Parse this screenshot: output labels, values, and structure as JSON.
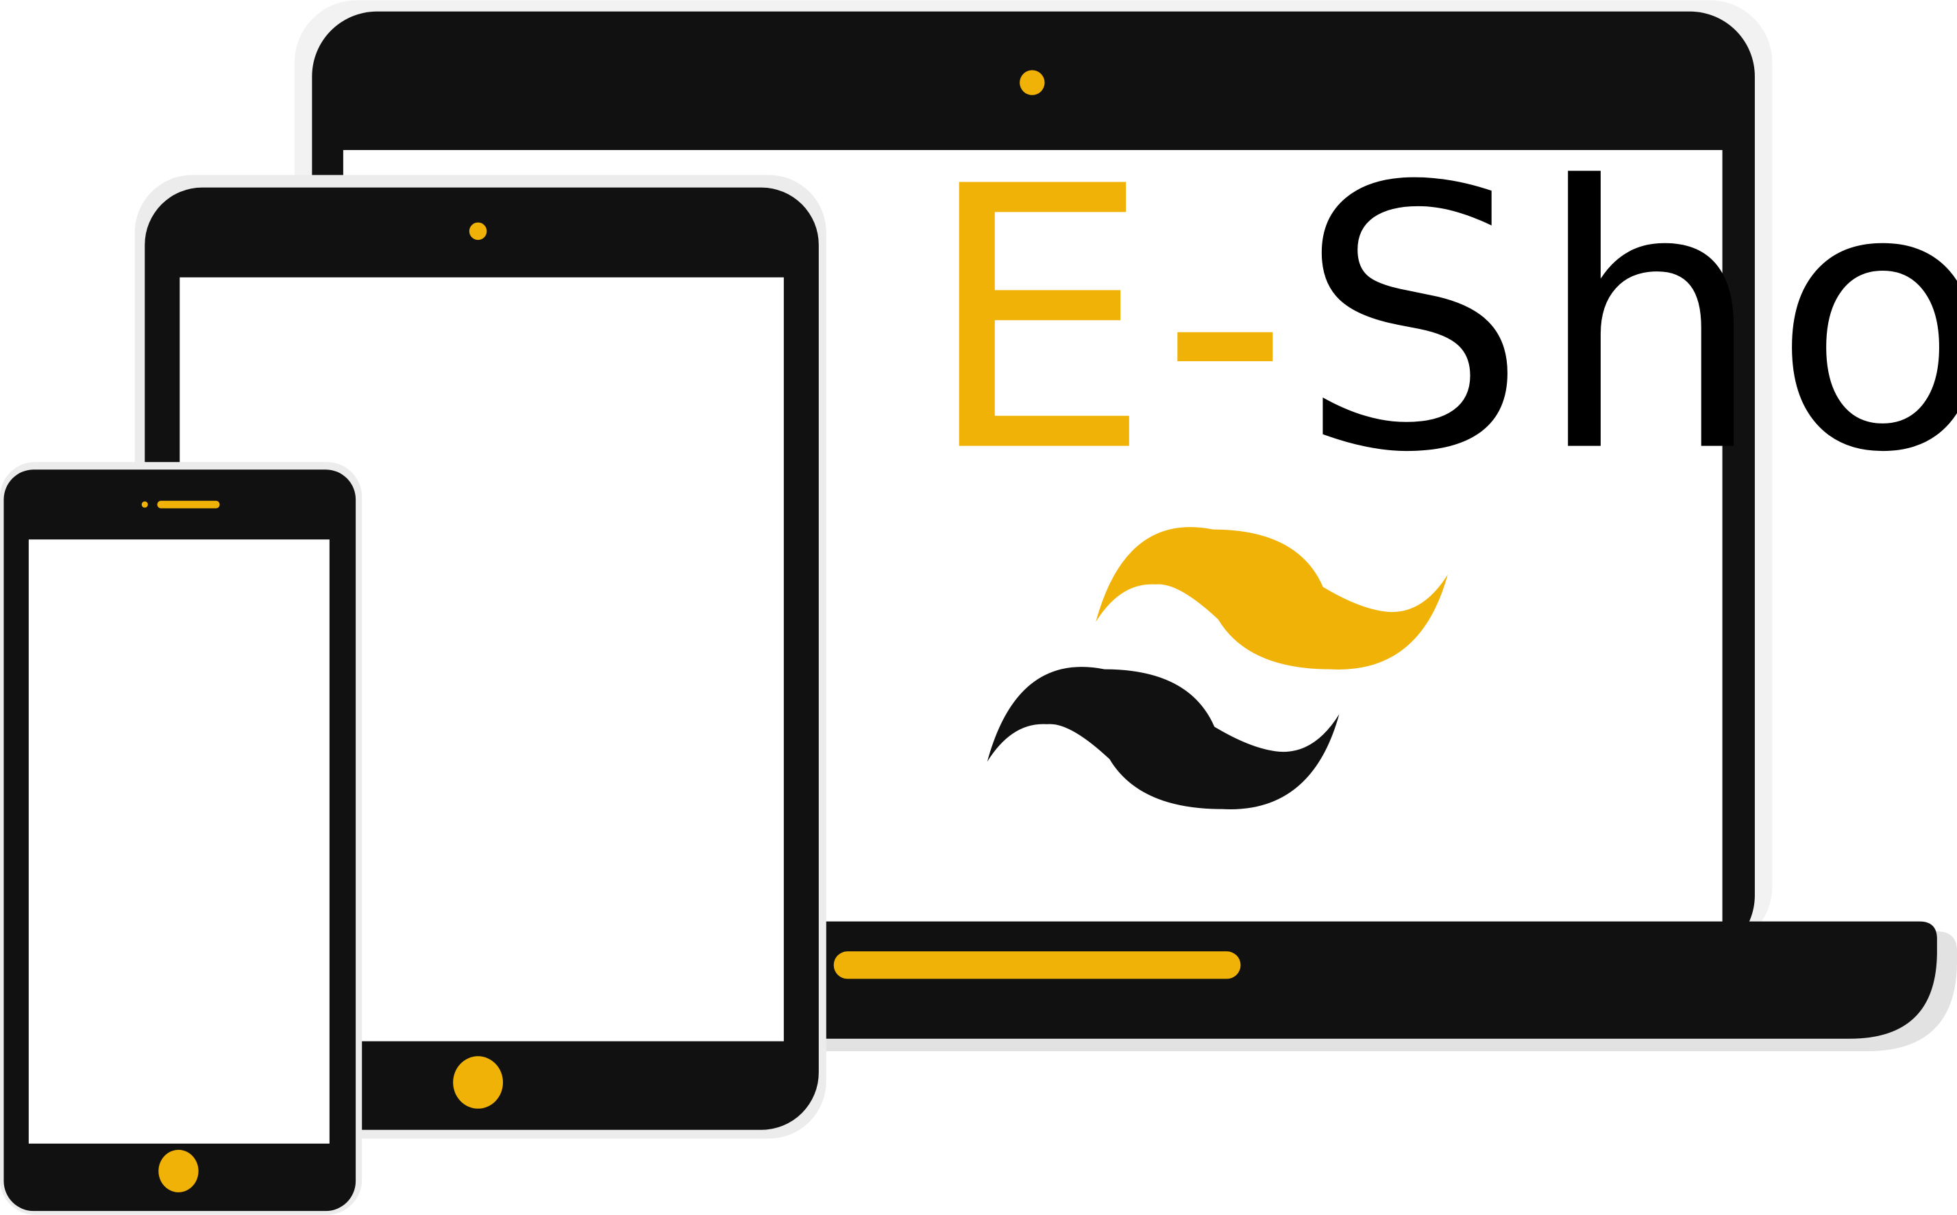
{
  "brand": {
    "prefix": "E-",
    "name": "Shop"
  },
  "colors": {
    "accent": "#f0b206",
    "device": "#111111",
    "screen": "#ffffff",
    "shadow": "#e9e9e9",
    "text": "#000000"
  },
  "icons": {
    "logo": "tailwind-wave-logo",
    "laptop_camera": "camera-dot",
    "tablet_camera": "camera-dot",
    "phone_speaker": "speaker-slot",
    "tablet_home": "home-button",
    "phone_home": "home-button",
    "laptop_trackpad": "trackpad-bar"
  }
}
